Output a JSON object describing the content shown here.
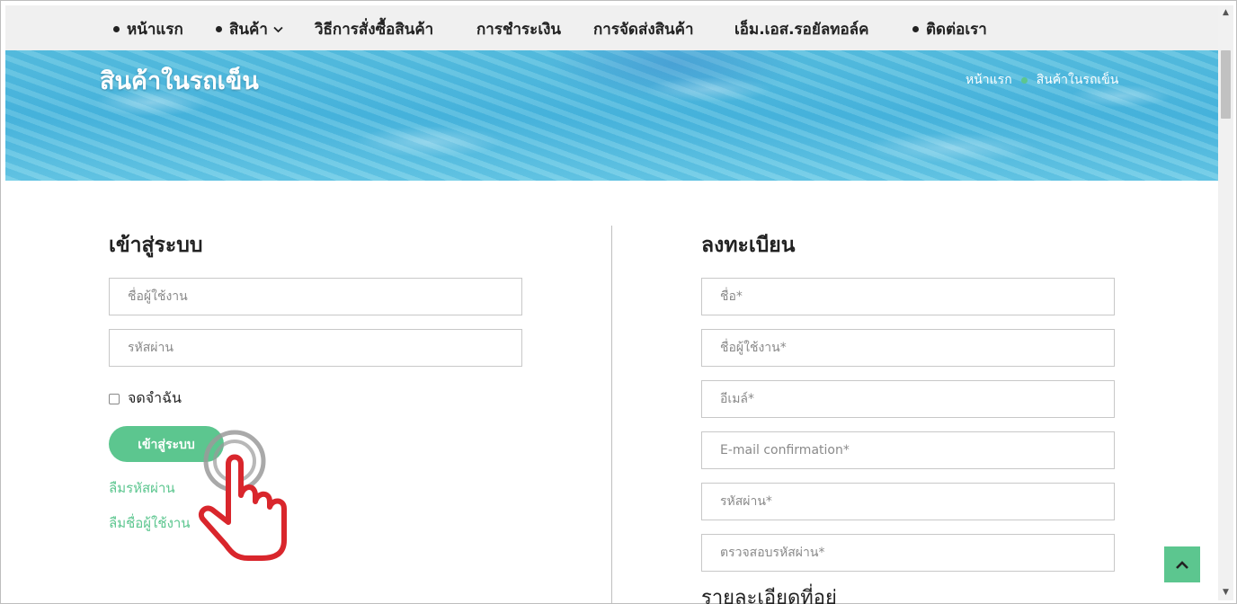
{
  "nav": {
    "items": [
      {
        "label": "หน้าแรก",
        "bullet": true,
        "dropdown": false
      },
      {
        "label": "สินค้า",
        "bullet": true,
        "dropdown": true
      },
      {
        "label": "วิธีการสั่งซื้อสินค้า",
        "bullet": false,
        "dropdown": false
      },
      {
        "label": "การชำระเงิน",
        "bullet": false,
        "dropdown": false
      },
      {
        "label": "การจัดส่งสินค้า",
        "bullet": false,
        "dropdown": false
      },
      {
        "label": "เอ็ม.เอส.รอยัลทอล์ค",
        "bullet": false,
        "dropdown": false
      },
      {
        "label": "ติดต่อเรา",
        "bullet": true,
        "dropdown": false
      }
    ]
  },
  "hero": {
    "title": "สินค้าในรถเข็น",
    "breadcrumb": [
      "หน้าแรก",
      "สินค้าในรถเข็น"
    ]
  },
  "login": {
    "title": "เข้าสู่ระบบ",
    "username_placeholder": "ชื่อผู้ใช้งาน",
    "password_placeholder": "รหัสผ่าน",
    "remember_label": "จดจำฉัน",
    "remember_checked": false,
    "submit_label": "เข้าสู่ระบบ",
    "forgot_password": "ลืมรหัสผ่าน",
    "forgot_username": "ลืมชื่อผู้ใช้งาน"
  },
  "register": {
    "title": "ลงทะเบียน",
    "fields": [
      {
        "placeholder": "ชื่อ*"
      },
      {
        "placeholder": "ชื่อผู้ใช้งาน*"
      },
      {
        "placeholder": "อีเมล์*"
      },
      {
        "placeholder": "E-mail confirmation*"
      },
      {
        "placeholder": "รหัสผ่าน*"
      },
      {
        "placeholder": "ตรวจสอบรหัสผ่าน*"
      }
    ],
    "address_heading": "รายละเอียดที่อยู่"
  },
  "colors": {
    "accent": "#5cc68f",
    "nav_bg": "#f0f0f0",
    "hand_outline": "#d9262c"
  },
  "icons": {
    "scroll_top": "chevron-up-icon",
    "nav_dropdown": "chevron-down-icon",
    "pointer": "hand-pointer-icon"
  }
}
